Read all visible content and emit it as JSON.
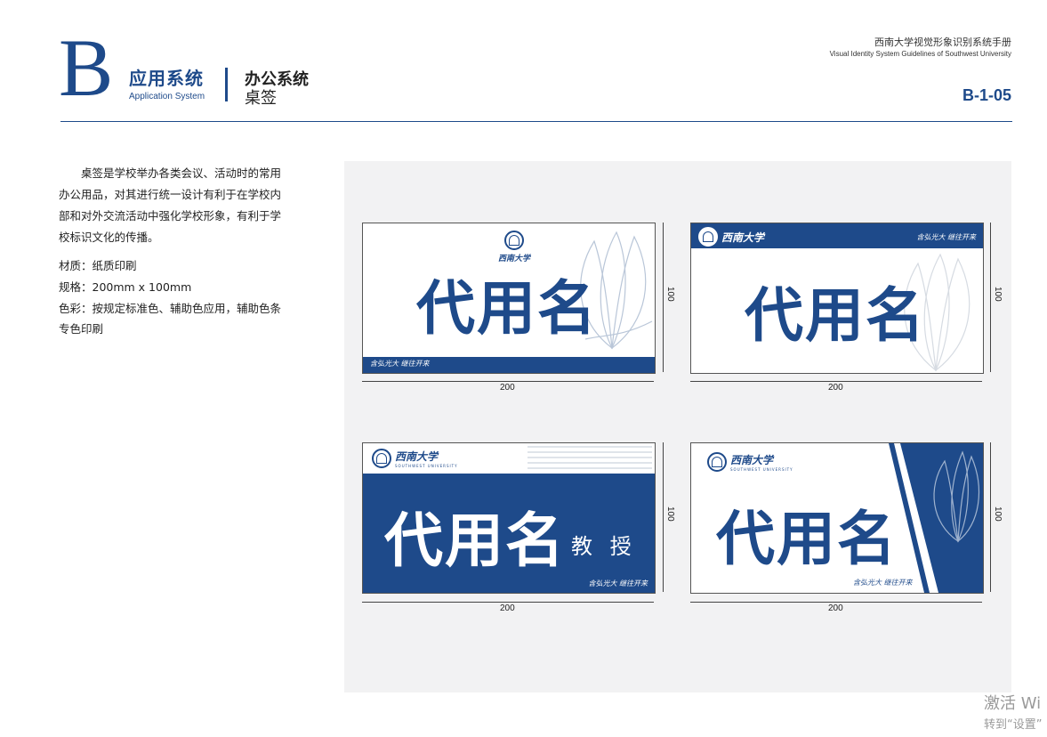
{
  "header": {
    "letter": "B",
    "section_cn": "应用系统",
    "section_en": "Application System",
    "subtitle_1": "办公系统",
    "subtitle_2": "桌签",
    "manual_cn": "西南大学视觉形象识别系统手册",
    "manual_en": "Visual Identity System Guidelines of Southwest University",
    "page_code": "B-1-05"
  },
  "body": {
    "description": "桌签是学校举办各类会议、活动时的常用办公用品，对其进行统一设计有利于在学校内部和对外交流活动中强化学校形象，有利于学校标识文化的传播。",
    "material": "材质：纸质印刷",
    "size": "规格：200mm x 100mm",
    "color": "色彩：按规定标准色、辅助色应用，辅助色条专色印刷"
  },
  "cards": {
    "name": "代用名",
    "title_suffix": "教 授",
    "logo_cn": "西南大学",
    "logo_en": "SOUTHWEST UNIVERSITY",
    "motto": "含弘光大  继往开来",
    "width_label": "200",
    "height_label": "100"
  },
  "watermark": {
    "line1": "激活 Wi",
    "line2": "转到“设置”"
  },
  "colors": {
    "brand": "#1e4a8a",
    "panel": "#f2f2f3"
  }
}
